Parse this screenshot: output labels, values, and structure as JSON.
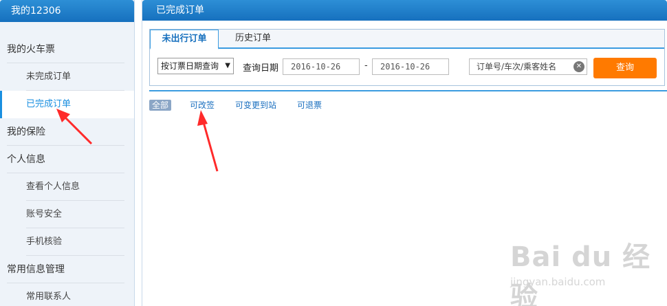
{
  "sidebar": {
    "title": "我的12306",
    "items": [
      {
        "label": "我的火车票"
      },
      {
        "label": "未完成订单"
      },
      {
        "label": "已完成订单"
      },
      {
        "label": "我的保险"
      },
      {
        "label": "个人信息"
      },
      {
        "label": "查看个人信息"
      },
      {
        "label": "账号安全"
      },
      {
        "label": "手机核验"
      },
      {
        "label": "常用信息管理"
      },
      {
        "label": "常用联系人"
      }
    ],
    "active_item": "已完成订单"
  },
  "main": {
    "title": "已完成订单",
    "tabs": [
      {
        "label": "未出行订单"
      },
      {
        "label": "历史订单"
      }
    ],
    "active_tab": "未出行订单",
    "query": {
      "select_value": "按订票日期查询",
      "date_label": "查询日期",
      "date_from": "2016-10-26",
      "date_to": "2016-10-26",
      "separator": "-",
      "search_placeholder": "订单号/车次/乘客姓名",
      "query_button": "查询"
    },
    "filters": [
      {
        "label": "全部"
      },
      {
        "label": "可改签"
      },
      {
        "label": "可变更到站"
      },
      {
        "label": "可退票"
      }
    ]
  },
  "watermark": {
    "logo": "Bai du 经验",
    "url": "jingyan.baidu.com"
  },
  "colors": {
    "header_blue": "#1670be",
    "accent_blue": "#1a8fe0",
    "query_button": "#ff7a00",
    "annotation_arrow": "#ff2a2a"
  }
}
